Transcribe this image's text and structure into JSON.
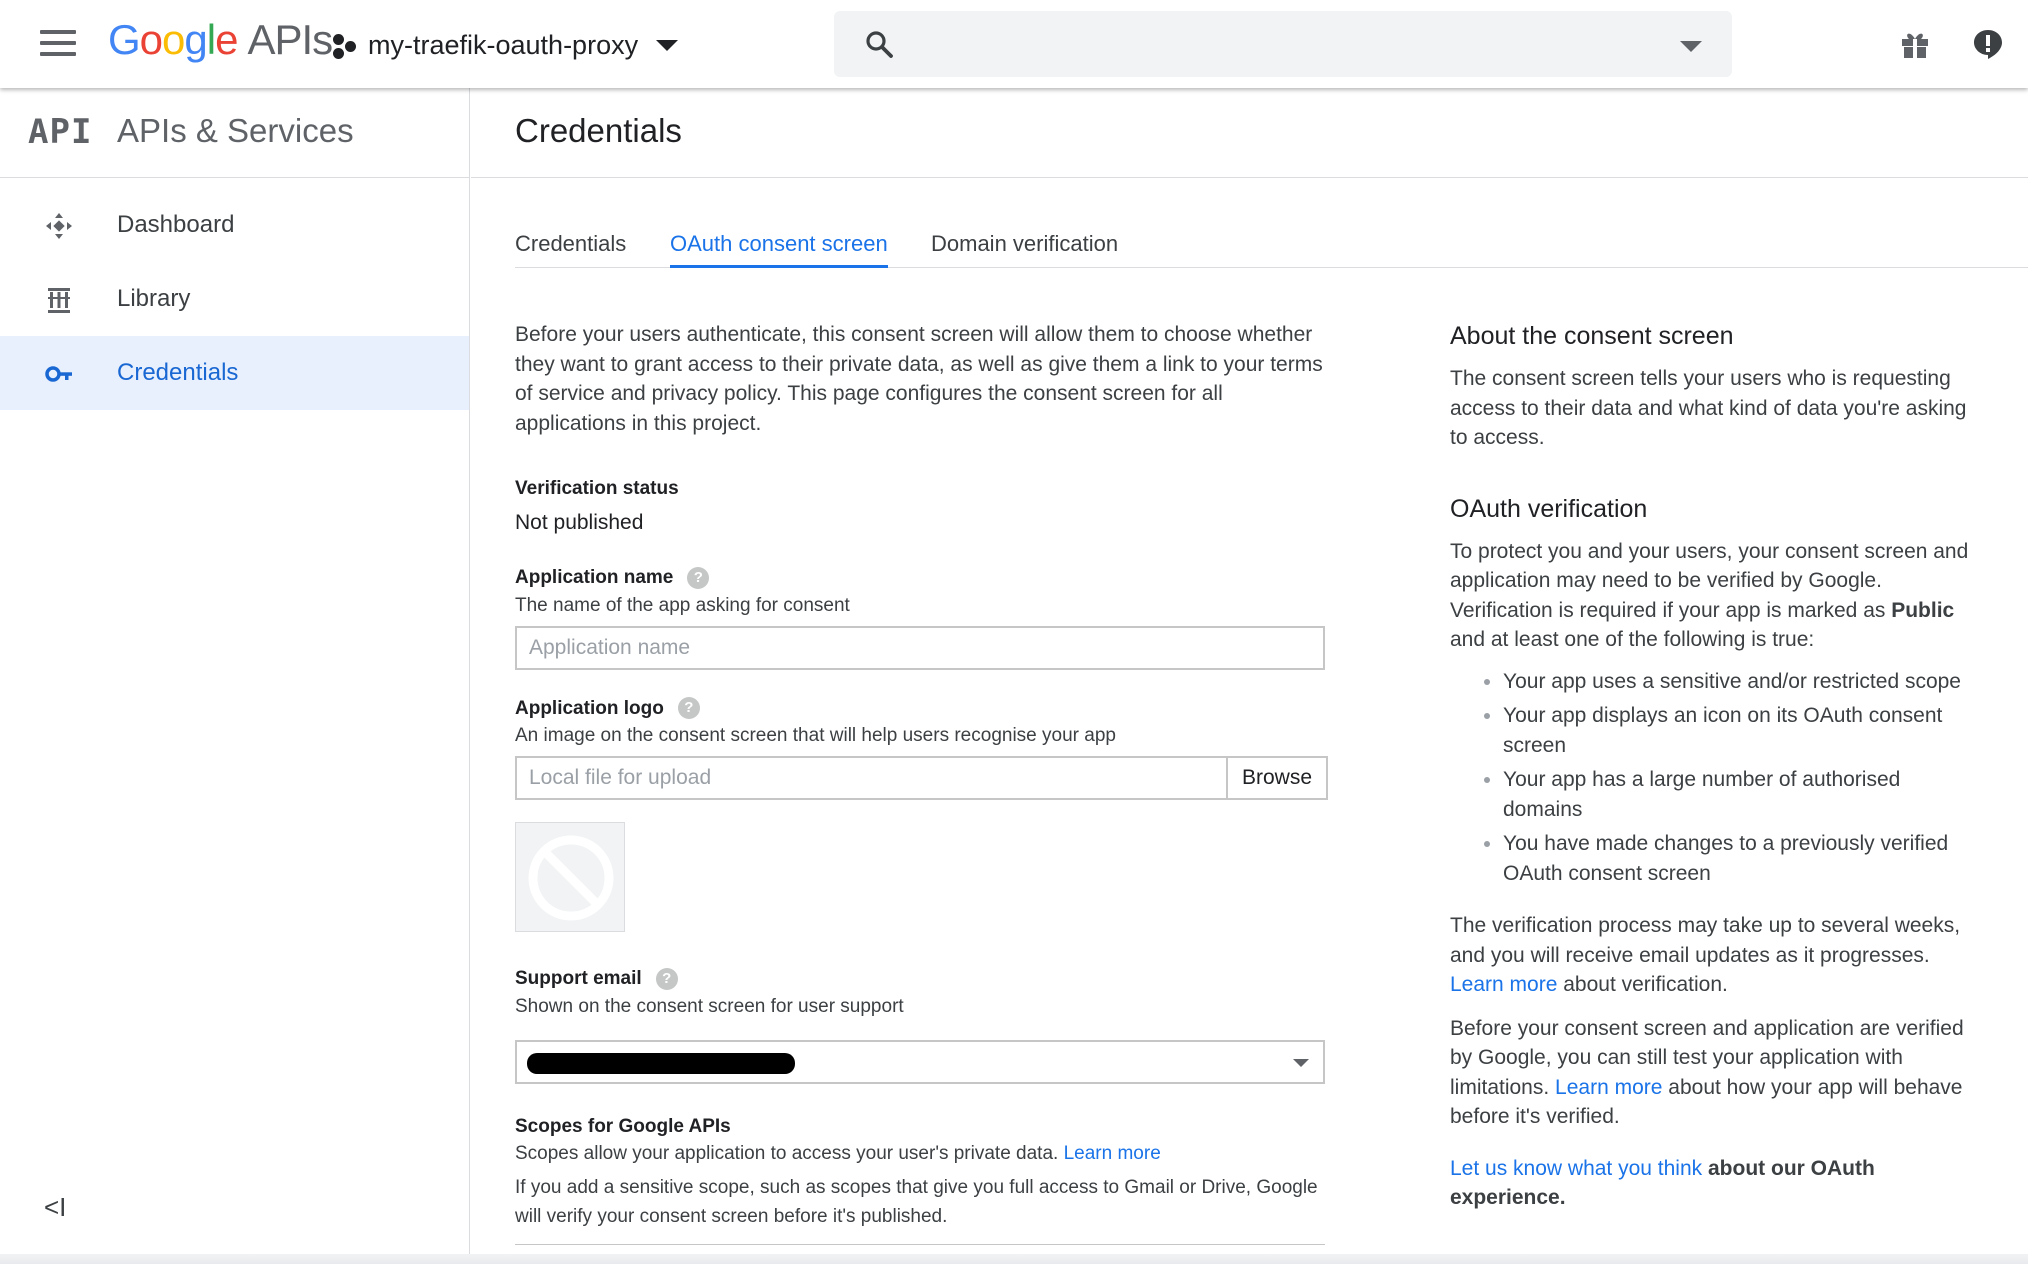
{
  "header": {
    "logo_letters": [
      "G",
      "o",
      "o",
      "g",
      "l",
      "e"
    ],
    "logo_suffix": "APIs",
    "project_name": "my-traefik-oauth-proxy",
    "search_placeholder": ""
  },
  "sidebar": {
    "badge": "API",
    "title": "APIs & Services",
    "items": [
      {
        "label": "Dashboard",
        "icon": "dashboard-icon",
        "active": false
      },
      {
        "label": "Library",
        "icon": "library-icon",
        "active": false
      },
      {
        "label": "Credentials",
        "icon": "key-icon",
        "active": true
      }
    ],
    "collapse_label": "<I"
  },
  "main": {
    "title": "Credentials",
    "tabs": [
      {
        "label": "Credentials",
        "active": false
      },
      {
        "label": "OAuth consent screen",
        "active": true
      },
      {
        "label": "Domain verification",
        "active": false
      }
    ]
  },
  "form": {
    "intro": "Before your users authenticate, this consent screen will allow them to choose whether they want to grant access to their private data, as well as give them a link to your terms of service and privacy policy. This page configures the consent screen for all applications in this project.",
    "verification_status_label": "Verification status",
    "verification_status_value": "Not published",
    "app_name_label": "Application name",
    "app_name_desc": "The name of the app asking for consent",
    "app_name_placeholder": "Application name",
    "app_logo_label": "Application logo",
    "app_logo_desc": "An image on the consent screen that will help users recognise your app",
    "app_logo_placeholder": "Local file for upload",
    "browse_label": "Browse",
    "support_email_label": "Support email",
    "support_email_desc": "Shown on the consent screen for user support",
    "scopes_label": "Scopes for Google APIs",
    "scopes_desc": "Scopes allow your application to access your user's private data.",
    "scopes_link": "Learn more",
    "scopes_note": "If you add a sensitive scope, such as scopes that give you full access to Gmail or Drive, Google will verify your consent screen before it's published.",
    "help_glyph": "?"
  },
  "about": {
    "heading": "About the consent screen",
    "text": "The consent screen tells your users who is requesting access to their data and what kind of data you're asking to access.",
    "oauth_heading": "OAuth verification",
    "oauth_text_1": "To protect you and your users, your consent screen and application may need to be verified by Google. Verification is required if your app is marked as",
    "oauth_text_bold": "Public",
    "oauth_text_2": "and at least one of the following is true:",
    "bullets": [
      "Your app uses a sensitive and/or restricted scope",
      "Your app displays an icon on its OAuth consent screen",
      "Your app has a large number of authorised domains",
      "You have made changes to a previously verified OAuth consent screen"
    ],
    "process_text": "The verification process may take up to several weeks, and you will receive email updates as it progresses.",
    "process_link": "Learn more",
    "process_suffix": "about verification.",
    "test_text": "Before your consent screen and application are verified by Google, you can still test your application with limitations.",
    "test_link": "Learn more",
    "test_suffix": "about how your app will behave before it's verified.",
    "feedback_link": "Let us know what you think",
    "feedback_suffix": "about our OAuth experience."
  },
  "colors": {
    "accent": "#1a73e8",
    "active_nav_bg": "#e8f0fe"
  }
}
